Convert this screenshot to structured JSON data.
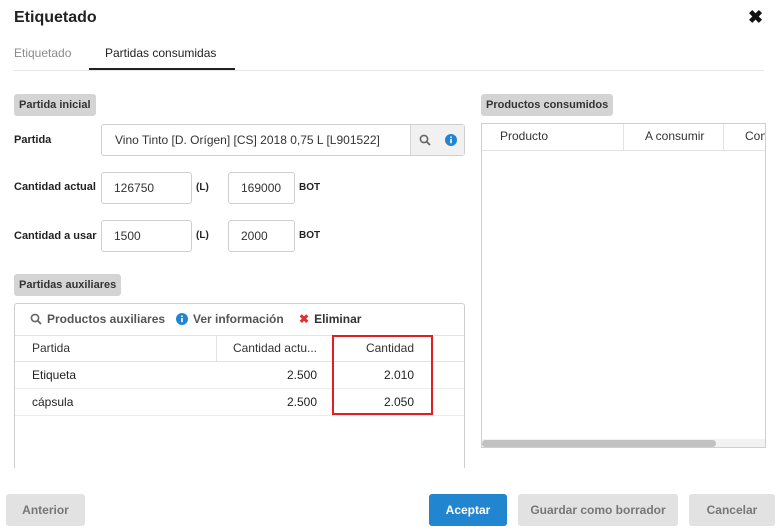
{
  "dialog": {
    "title": "Etiquetado",
    "close_glyph": "✖"
  },
  "tabs": [
    {
      "label": "Etiquetado"
    },
    {
      "label": "Partidas consumidas"
    }
  ],
  "partida_inicial": {
    "section": "Partida inicial",
    "partida_label": "Partida",
    "partida_value": "Vino Tinto [D. Orígen] [CS] 2018 0,75 L [L901522]",
    "cantidad_actual_label": "Cantidad actual",
    "cantidad_actual_l": "126750",
    "cantidad_actual_bot": "169000",
    "cantidad_usar_label": "Cantidad a usar",
    "cantidad_usar_l": "1500",
    "cantidad_usar_bot": "2000",
    "unit_l": "(L)",
    "unit_bot": "BOT"
  },
  "partidas_auxiliares": {
    "section": "Partidas auxiliares",
    "toolbar": {
      "productos": "Productos auxiliares",
      "ver_info": "Ver información",
      "eliminar": "Eliminar"
    },
    "columns": [
      "Partida",
      "Cantidad actu...",
      "Cantidad"
    ],
    "rows": [
      {
        "partida": "Etiqueta",
        "actual": "2.500",
        "cantidad": "2.010"
      },
      {
        "partida": "cápsula",
        "actual": "2.500",
        "cantidad": "2.050"
      }
    ]
  },
  "productos_consumidos": {
    "section": "Productos consumidos",
    "columns": [
      "Producto",
      "A consumir",
      "Con"
    ]
  },
  "footer": {
    "anterior": "Anterior",
    "aceptar": "Aceptar",
    "guardar": "Guardar como borrador",
    "cancelar": "Cancelar"
  },
  "colors": {
    "accent": "#2185d0",
    "highlight": "#e02020",
    "info": "#2185d0",
    "danger": "#e03030"
  }
}
